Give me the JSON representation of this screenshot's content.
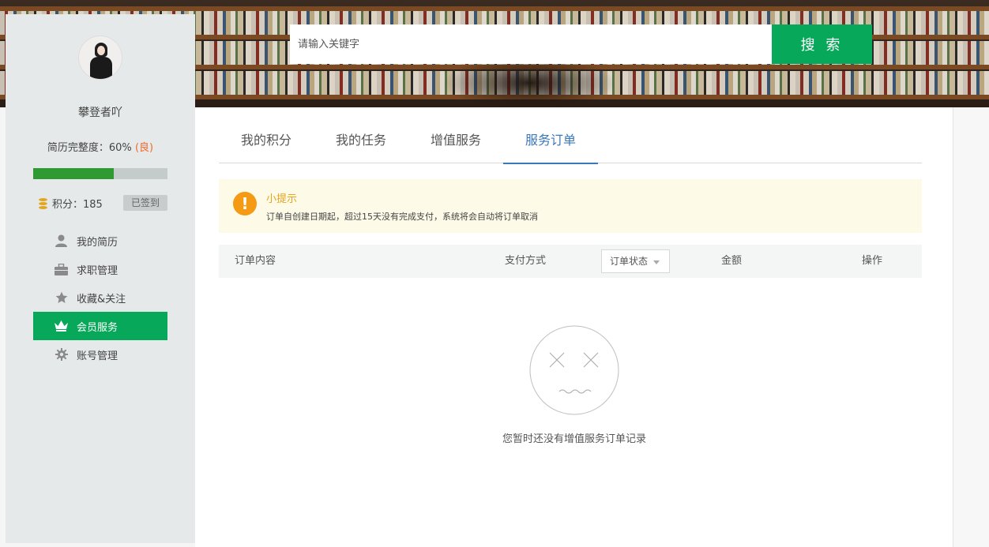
{
  "search": {
    "placeholder": "请输入关键字",
    "button_label": "搜 索"
  },
  "profile": {
    "username": "攀登者吖",
    "completeness_label": "简历完整度：60%",
    "completeness_grade": "(良)",
    "completeness_fraction": 0.6,
    "points_label": "积分：185",
    "signed_label": "已签到"
  },
  "sidebar": {
    "items": [
      {
        "label": "我的简历",
        "icon": "user-icon"
      },
      {
        "label": "求职管理",
        "icon": "briefcase-icon"
      },
      {
        "label": "收藏&关注",
        "icon": "star-icon"
      },
      {
        "label": "会员服务",
        "icon": "crown-icon",
        "active": true
      },
      {
        "label": "账号管理",
        "icon": "gear-icon"
      }
    ]
  },
  "tabs": [
    "我的积分",
    "我的任务",
    "增值服务",
    "服务订单"
  ],
  "active_tab": 3,
  "tip": {
    "title": "小提示",
    "text": "订单自创建日期起，超过15天没有完成支付，系统将会自动将订单取消"
  },
  "table": {
    "col_content": "订单内容",
    "col_payment": "支付方式",
    "col_status": "订单状态",
    "col_amount": "金额",
    "col_action": "操作"
  },
  "empty": {
    "message": "您暂时还没有增值服务订单记录"
  },
  "colors": {
    "accent_green": "#08a85a",
    "progress_green": "#2e9a31",
    "tab_active_blue": "#3b78b8",
    "grade_orange": "#f06a2b",
    "tip_orange": "#f59a14"
  }
}
